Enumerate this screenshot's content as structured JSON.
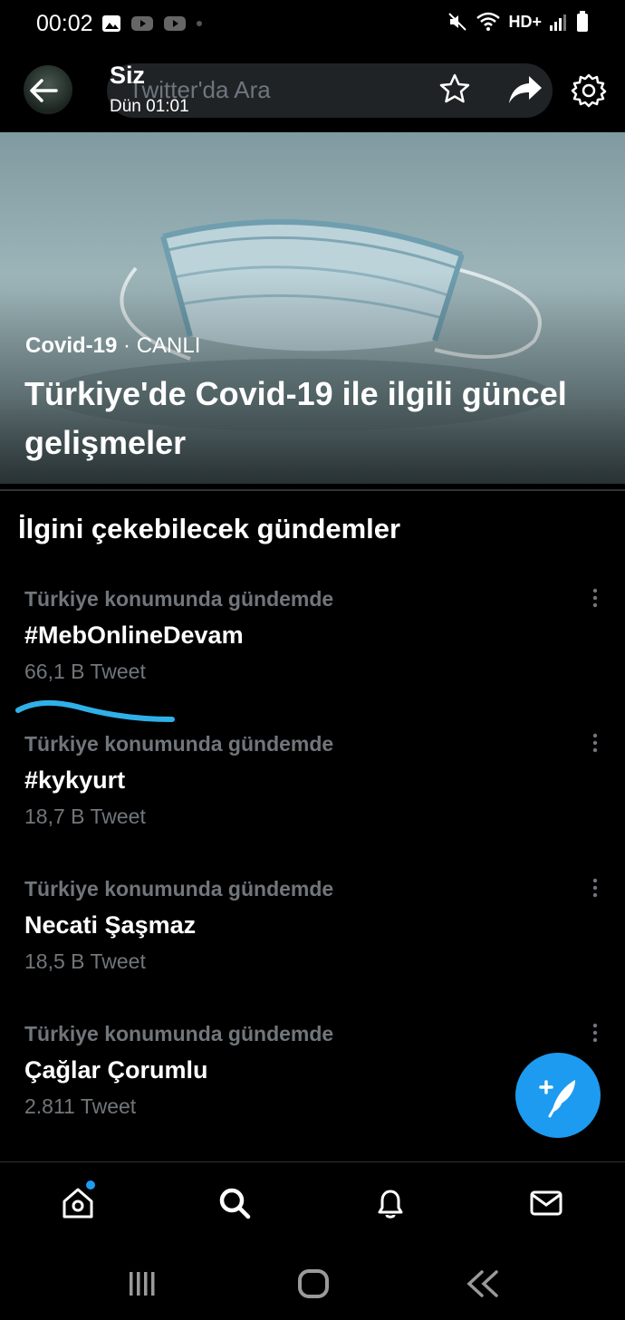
{
  "status_bar": {
    "time": "00:02",
    "network": "HD+"
  },
  "top_bar": {
    "search_placeholder": "Twitter'da Ara",
    "chat_name": "Siz",
    "chat_subtitle": "Dün 01:01"
  },
  "hero": {
    "category": "Covid-19",
    "separator": " · ",
    "live_label": "CANLI",
    "title": "Türkiye'de Covid-19 ile ilgili güncel gelişmeler"
  },
  "section_title": "İlgini çekebilecek gündemler",
  "trends": [
    {
      "context": "Türkiye konumunda gündemde",
      "name": "#MebOnlineDevam",
      "count": "66,1 B Tweet"
    },
    {
      "context": "Türkiye konumunda gündemde",
      "name": "#kykyurt",
      "count": "18,7 B Tweet"
    },
    {
      "context": "Türkiye konumunda gündemde",
      "name": "Necati Şaşmaz",
      "count": "18,5 B Tweet"
    },
    {
      "context": "Türkiye konumunda gündemde",
      "name": "Çağlar Çorumlu",
      "count": "2.811 Tweet"
    }
  ],
  "colors": {
    "accent": "#1d9bf0",
    "background": "#000000",
    "secondary_text": "#71767b",
    "annotation_underline": "#2fb0e8"
  },
  "icons": {
    "top_bar": [
      "back-arrow-icon",
      "star-icon",
      "share-icon",
      "gear-icon"
    ],
    "bottom_nav": [
      "home-icon",
      "search-icon",
      "notifications-bell-icon",
      "messages-envelope-icon"
    ],
    "system_nav": [
      "recent-apps-icon",
      "home-button-icon",
      "back-icon"
    ]
  }
}
